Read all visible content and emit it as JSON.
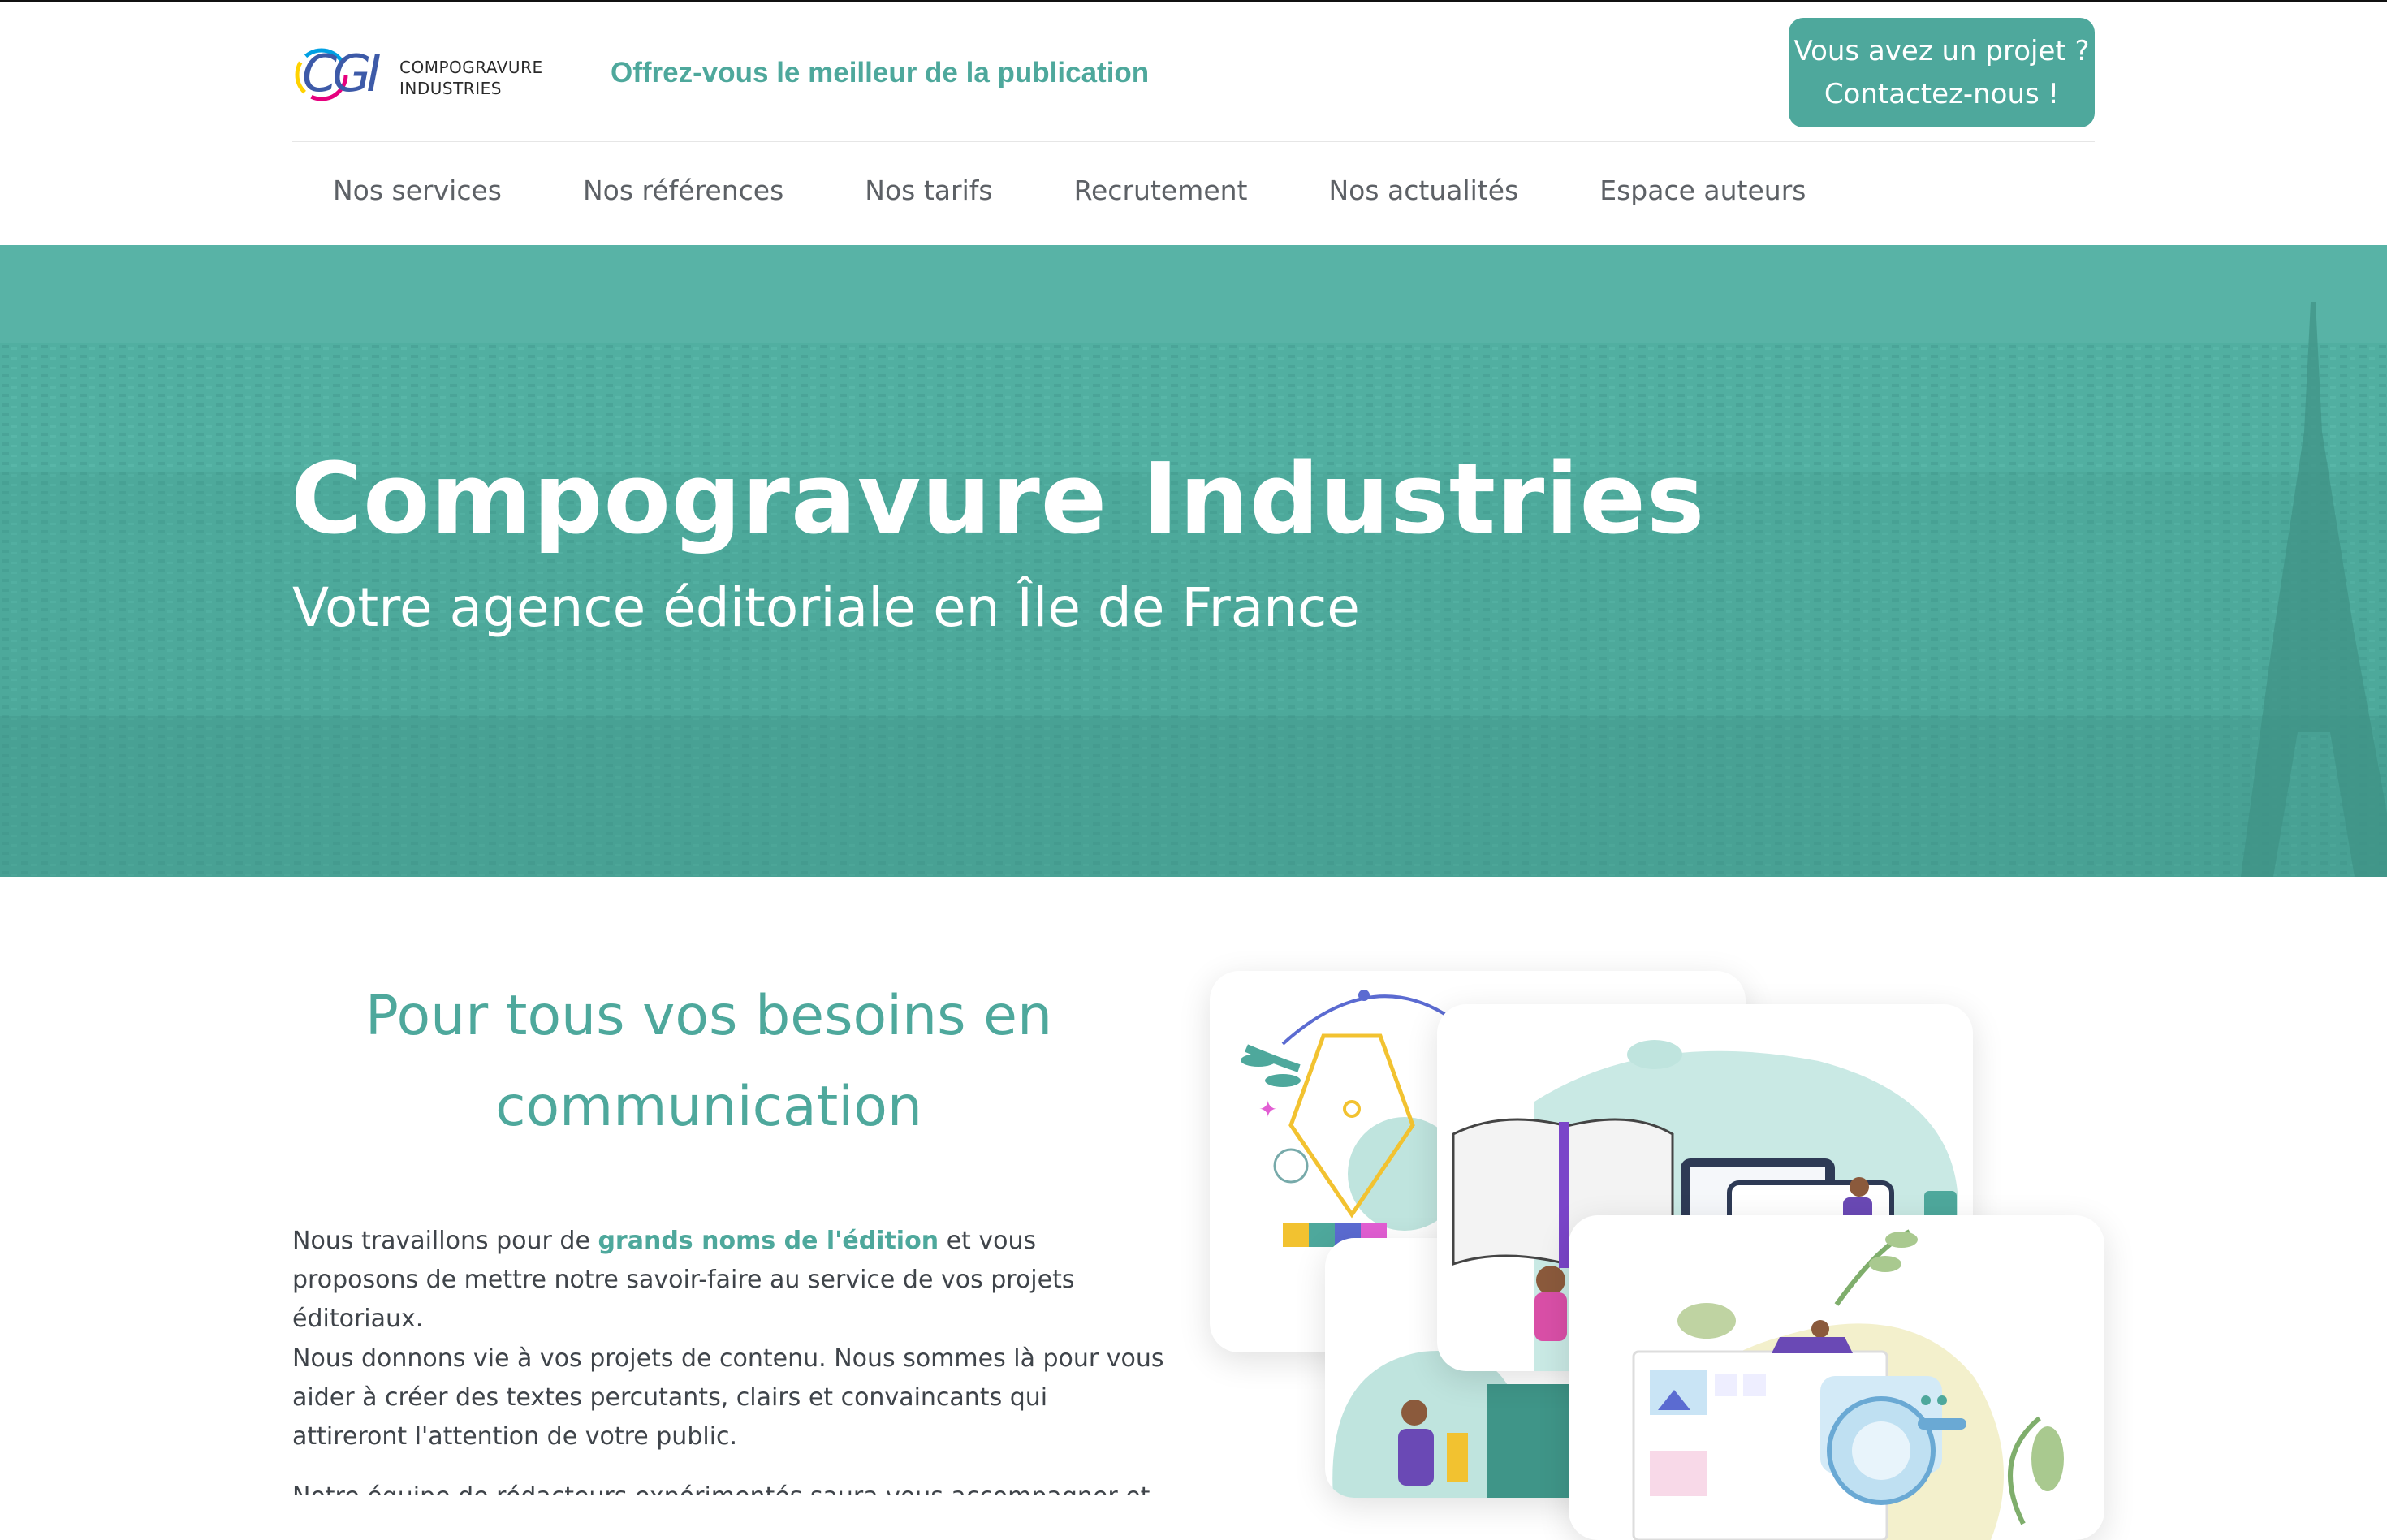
{
  "header": {
    "logo_mark": "CGI",
    "logo_line1": "COMPOGRAVURE",
    "logo_line2": "INDUSTRIES",
    "tagline": "Offrez-vous le meilleur de la publication",
    "cta_line1": "Vous avez un projet ?",
    "cta_line2": "Contactez-nous !"
  },
  "nav": {
    "items": [
      {
        "label": "Nos services"
      },
      {
        "label": "Nos références"
      },
      {
        "label": "Nos tarifs"
      },
      {
        "label": "Recrutement"
      },
      {
        "label": "Nos actualités"
      },
      {
        "label": "Espace auteurs"
      }
    ]
  },
  "hero": {
    "title": "Compogravure Industries",
    "subtitle": "Votre agence éditoriale en Île de France"
  },
  "main": {
    "section_title_line1": "Pour tous vos besoins en",
    "section_title_line2": "communication",
    "p1_before": "Nous travaillons pour de ",
    "p1_highlight": "grands noms de l'édition",
    "p1_after": " et vous proposons de mettre notre savoir-faire au service de vos projets éditoriaux.",
    "p2": "Nous donnons vie à vos projets de contenu. Nous sommes là pour vous aider à créer des textes percutants, clairs et convaincants qui attireront l'attention de votre public.",
    "p3": "Notre équipe de rédacteurs expérimentés saura vous accompagner et conseiller"
  },
  "colors": {
    "accent": "#4ea89c",
    "hero_bg": "#4faea0",
    "text": "#3f444a"
  },
  "icons": [
    "logo-icon",
    "pen-nib-illustration",
    "book-devices-illustration",
    "camera-illustration"
  ]
}
